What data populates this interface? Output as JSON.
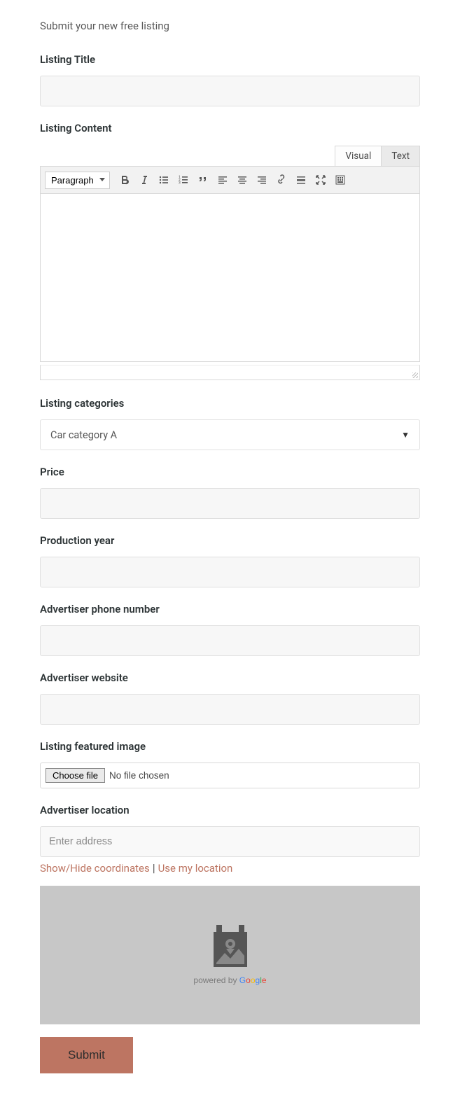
{
  "subtitle": "Submit your new free listing",
  "labels": {
    "title": "Listing Title",
    "content": "Listing Content",
    "categories": "Listing categories",
    "price": "Price",
    "year": "Production year",
    "phone": "Advertiser phone number",
    "website": "Advertiser website",
    "image": "Listing featured image",
    "location": "Advertiser location"
  },
  "editor": {
    "tabs": {
      "visual": "Visual",
      "text": "Text"
    },
    "format_selected": "Paragraph",
    "value": ""
  },
  "category": {
    "selected": "Car category A"
  },
  "file": {
    "button": "Choose file",
    "status": "No file chosen"
  },
  "location": {
    "placeholder": "Enter address",
    "toggle_coords": "Show/Hide coordinates",
    "use_my_location": "Use my location",
    "powered_by": "powered by "
  },
  "submit": "Submit",
  "values": {
    "title": "",
    "price": "",
    "year": "",
    "phone": "",
    "website": "",
    "address": ""
  }
}
